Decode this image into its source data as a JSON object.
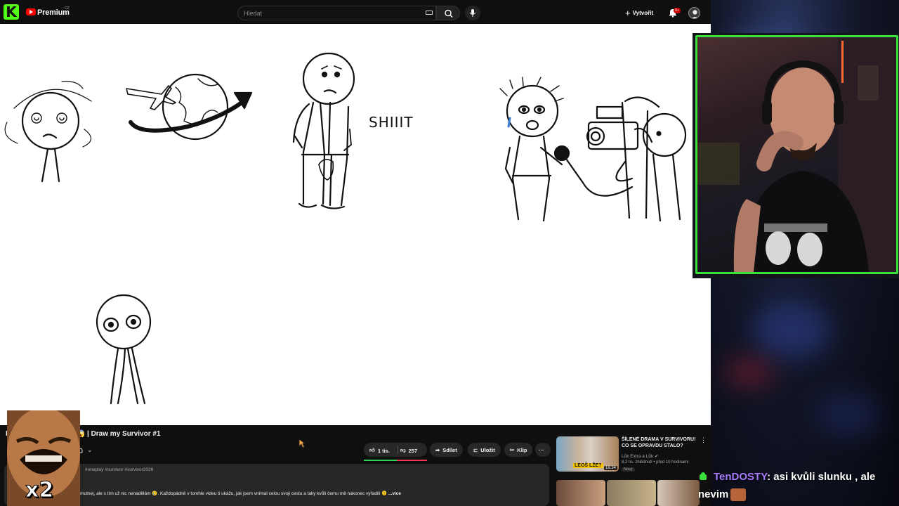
{
  "topbar": {
    "brand": "Premium",
    "brand_country": "CZ",
    "search_placeholder": "Hledat",
    "create_label": "Vytvořit",
    "notification_count": "9+"
  },
  "video": {
    "caption_word": "SHIIIT"
  },
  "below": {
    "title": "P... E SURVIVORU?!! 😱 | Draw my Survivor #1",
    "like_count": "1 tis.",
    "dislike_count": "257",
    "share_label": "Sdílet",
    "save_label": "Uložit",
    "clip_label": "Klip",
    "more_label": "···",
    "like_ratio": 0.52,
    "tags": "#oneplay #survivor #survivor2026",
    "description": "Tak jse... ma. Jsem z toho trochu smutnej, ale s tím už nic nenadělám 🥲. Každopádně v tomhle videu ti ukážu, jak jsem vnímal celou svoji cestu a taky kvůli čemu mě nakonec vyřadili 🫠",
    "description_more": "...více"
  },
  "recommendation": {
    "title": "ŠÍLENÉ DRAMA V SURVIVORU! CO SE OPRAVDU STALO?",
    "channel": "Lůk Extra a Lůk",
    "meta": "8,2 tis. zhlédnutí • před 10 hodinami",
    "badge": "Nový",
    "duration": "16:34",
    "thumb_label": "LEOŠ LŽE?"
  },
  "overlay": {
    "emote_multiplier": "x2",
    "chat_user": "TenDOSTY",
    "chat_message_1": ": asi kvůli slunku , ale",
    "chat_message_2": "nevim"
  },
  "colors": {
    "kick_green": "#53fc18",
    "webcam_border": "#39e03a",
    "yt_red": "#ff0000",
    "chat_name": "#a97bff"
  }
}
